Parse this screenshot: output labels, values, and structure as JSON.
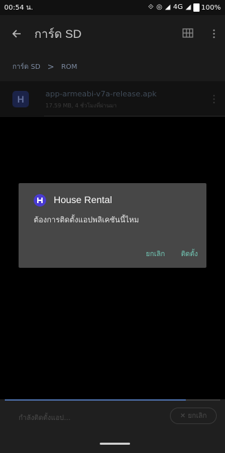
{
  "status_bar": {
    "time": "00:54 น.",
    "network": "4G",
    "battery": "100%"
  },
  "app_bar": {
    "title": "การ์ด SD",
    "icons": [
      "back-arrow-icon",
      "grid-view-icon",
      "more-vert-icon"
    ]
  },
  "breadcrumb": {
    "items": [
      "การ์ด SD",
      "ROM"
    ],
    "separator": ">"
  },
  "file": {
    "name": "app-armeabi-v7a-release.apk",
    "meta": "17.59 MB, 4 ชั่วโมงที่ผ่านมา"
  },
  "dialog": {
    "app_name": "House Rental",
    "message": "ต้องการติดตั้งแอปพลิเคชันนี้ไหม",
    "cancel_label": "ยกเลิก",
    "install_label": "ติดตั้ง"
  },
  "progress": {
    "label": "กำลังติดตั้งแอป...",
    "cancel_label": "ยกเลิก",
    "fraction": 0.84
  },
  "colors": {
    "accent": "#73c8b6",
    "app_icon": "#4a3bd1",
    "dialog_bg": "#474747",
    "progress": "#4c6ea8"
  }
}
